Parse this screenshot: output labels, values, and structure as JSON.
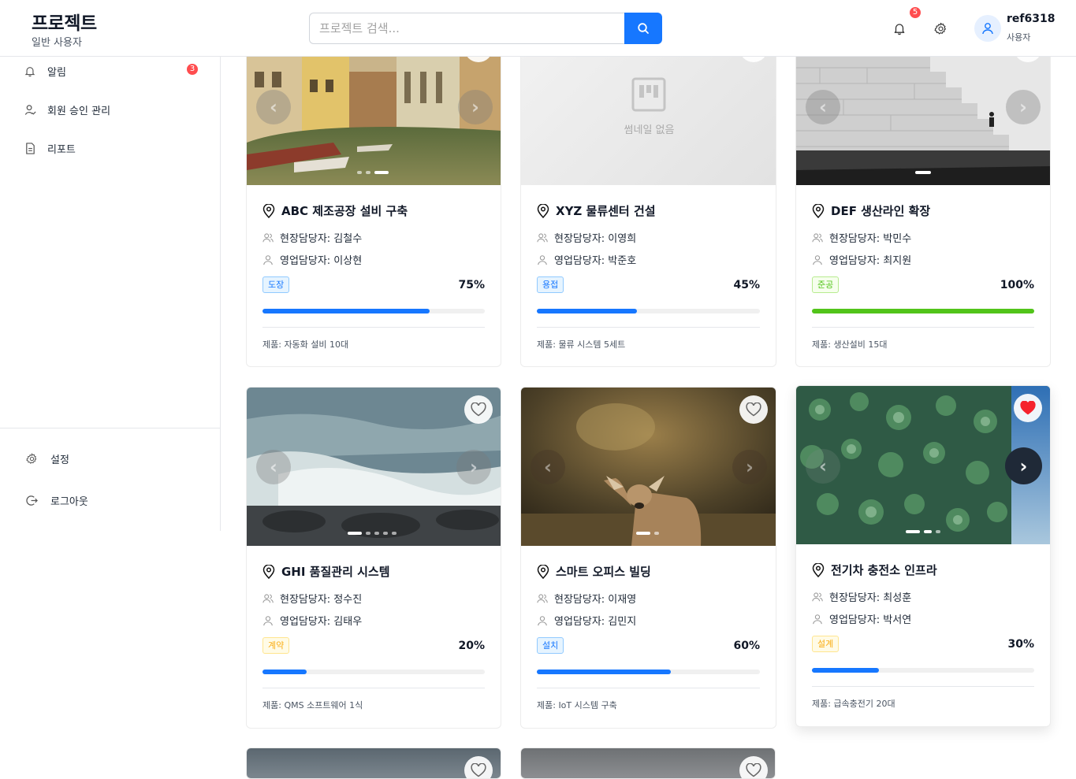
{
  "header": {
    "title": "프로젝트",
    "subtitle": "일반 사용자",
    "search_placeholder": "프로젝트 검색...",
    "notification_count": "5",
    "user_name": "ref6318",
    "user_role": "사용자",
    "accent_color": "#1677ff"
  },
  "sidebar": {
    "items": [
      {
        "label": "알림",
        "icon": "bell-icon",
        "badge": "3"
      },
      {
        "label": "회원 승인 관리",
        "icon": "user-check-icon"
      },
      {
        "label": "리포트",
        "icon": "document-icon"
      }
    ],
    "bottom_items": [
      {
        "label": "설정",
        "icon": "gear-icon"
      },
      {
        "label": "로그아웃",
        "icon": "logout-icon"
      }
    ]
  },
  "projects": [
    {
      "name": "ABC 제조공장 설비 구축",
      "site_manager": "현장담당자: 김철수",
      "sales_manager": "영업담당자: 이상현",
      "stage": "도장",
      "stage_color": "blue",
      "progress": 75,
      "progress_label": "75%",
      "product": "제품: 자동화 설비 10대",
      "favorite": false,
      "image": "canal"
    },
    {
      "name": "XYZ 물류센터 건설",
      "site_manager": "현장담당자: 이영희",
      "sales_manager": "영업담당자: 박준호",
      "stage": "용접",
      "stage_color": "blue",
      "progress": 45,
      "progress_label": "45%",
      "product": "제품: 물류 시스템 5세트",
      "favorite": false,
      "image": "none",
      "no_thumbnail": "썸네일 없음"
    },
    {
      "name": "DEF 생산라인 확장",
      "site_manager": "현장담당자: 박민수",
      "sales_manager": "영업담당자: 최지원",
      "stage": "준공",
      "stage_color": "green",
      "progress": 100,
      "progress_label": "100%",
      "product": "제품: 생산설비 15대",
      "favorite": false,
      "image": "stairs"
    },
    {
      "name": "GHI 품질관리 시스템",
      "site_manager": "현장담당자: 정수진",
      "sales_manager": "영업담당자: 김태우",
      "stage": "계약",
      "stage_color": "gold",
      "progress": 20,
      "progress_label": "20%",
      "product": "제품: QMS 소프트웨어 1식",
      "favorite": false,
      "image": "sea"
    },
    {
      "name": "스마트 오피스 빌딩",
      "site_manager": "현장담당자: 이재영",
      "sales_manager": "영업담당자: 김민지",
      "stage": "설치",
      "stage_color": "blue",
      "progress": 60,
      "progress_label": "60%",
      "product": "제품: IoT 시스템 구축",
      "favorite": false,
      "image": "deer"
    },
    {
      "name": "전기차 충전소 인프라",
      "site_manager": "현장담당자: 최성훈",
      "sales_manager": "영업담당자: 박서연",
      "stage": "설계",
      "stage_color": "gold",
      "progress": 30,
      "progress_label": "30%",
      "product": "제품: 급속충전기 20대",
      "favorite": true,
      "image": "succulent"
    }
  ]
}
